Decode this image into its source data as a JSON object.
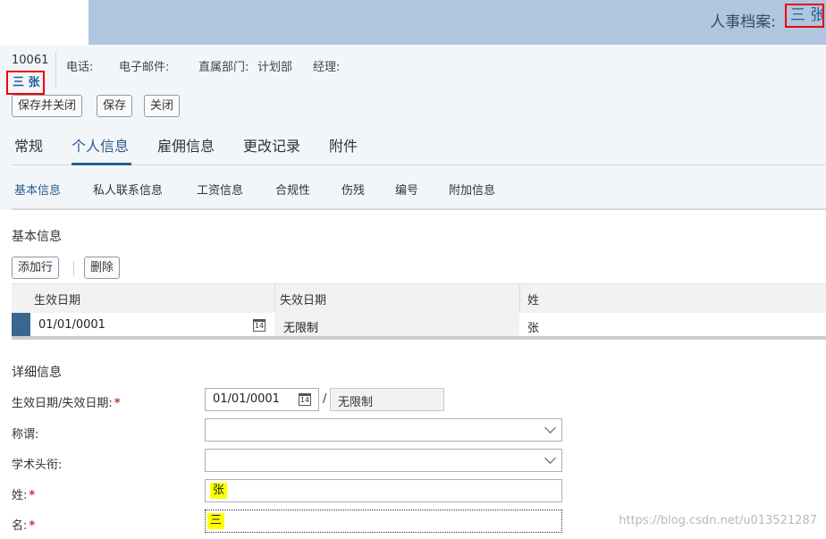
{
  "header": {
    "title": "人事档案:",
    "name": "三 张"
  },
  "employee": {
    "id": "10061",
    "name": "三 张",
    "phone_label": "电话:",
    "email_label": "电子邮件:",
    "dept_label": "直属部门:",
    "dept_value": "计划部",
    "manager_label": "经理:"
  },
  "toolbar": {
    "save_close": "保存并关闭",
    "save": "保存",
    "close": "关闭"
  },
  "tabs": [
    "常规",
    "个人信息",
    "雇佣信息",
    "更改记录",
    "附件"
  ],
  "subtabs": [
    "基本信息",
    "私人联系信息",
    "工资信息",
    "合规性",
    "伤残",
    "编号",
    "附加信息"
  ],
  "basic": {
    "title": "基本信息",
    "add_row": "添加行",
    "delete": "删除",
    "columns": [
      "生效日期",
      "失效日期",
      "姓"
    ],
    "row": {
      "start": "01/01/0001",
      "end": "无限制",
      "last": "张"
    },
    "cal_day": "14"
  },
  "detail": {
    "title": "详细信息",
    "date_label": "生效日期/失效日期:",
    "date_start": "01/01/0001",
    "date_sep": "/",
    "date_end": "无限制",
    "title_label": "称谓:",
    "academic_label": "学术头衔:",
    "last_label": "姓:",
    "last_value": "张",
    "first_label": "名:",
    "first_value": "三",
    "required_mark": "*"
  },
  "watermark": "https://blog.csdn.net/u013521287",
  "colors": {
    "header_bar": "#aec6df",
    "accent": "#2b5e8c",
    "highlight": "#ffff00",
    "required": "#c0392b"
  }
}
